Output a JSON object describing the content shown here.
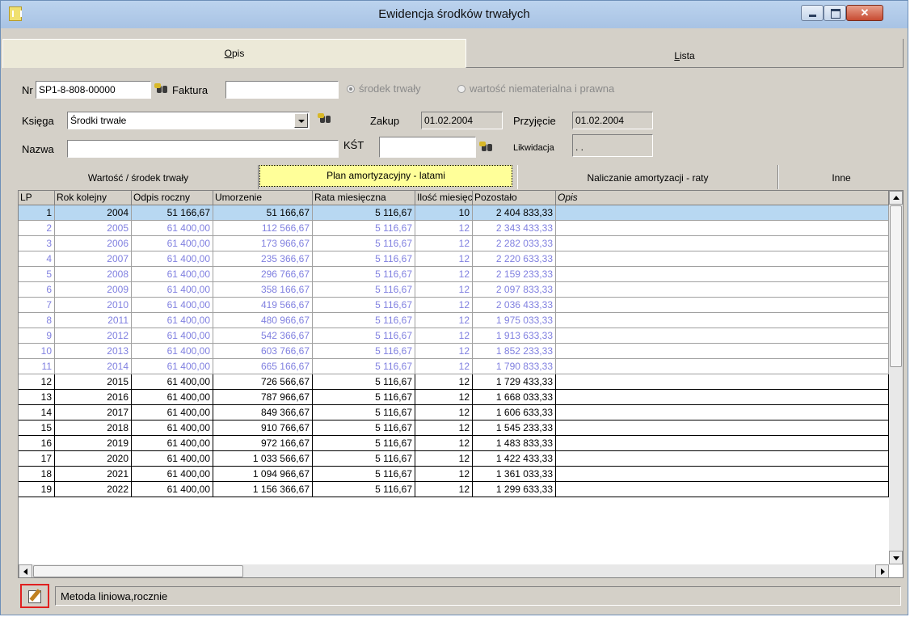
{
  "window": {
    "title": "Ewidencja środków trwałych"
  },
  "tabs_top": {
    "opis_prefix": "",
    "opis_underline": "O",
    "opis_rest": "pis",
    "lista_underline": "L",
    "lista_rest": "ista"
  },
  "form": {
    "nr_label": "Nr",
    "nr_value": "SP1-8-808-00000",
    "faktura_label": "Faktura",
    "faktura_value": "",
    "radio_srodek": "środek trwały",
    "radio_wartosc": "wartość niematerialna i prawna",
    "ksiega_label": "Księga",
    "ksiega_value": "Środki trwałe",
    "zakup_label": "Zakup",
    "zakup_value": "01.02.2004",
    "przyjecie_label": "Przyjęcie",
    "przyjecie_value": "01.02.2004",
    "nazwa_label": "Nazwa",
    "nazwa_value": "",
    "kst_label": "KŚT",
    "kst_value": "",
    "likwidacja_label": "Likwidacja",
    "likwidacja_value": " . ."
  },
  "tabs2": {
    "wartosc": "Wartość / środek trwały",
    "plan": "Plan amortyzacyjny - latami",
    "naliczanie": "Naliczanie amortyzacji - raty",
    "inne": "Inne"
  },
  "grid": {
    "columns": [
      "LP",
      "Rok kolejny",
      "Odpis roczny",
      "Umorzenie",
      "Rata miesięczna",
      "Ilość miesięcy",
      "Pozostało",
      "Opis"
    ],
    "rows": [
      [
        "1",
        "2004",
        "51 166,67",
        "51 166,67",
        "5 116,67",
        "10",
        "2 404 833,33",
        ""
      ],
      [
        "2",
        "2005",
        "61 400,00",
        "112 566,67",
        "5 116,67",
        "12",
        "2 343 433,33",
        ""
      ],
      [
        "3",
        "2006",
        "61 400,00",
        "173 966,67",
        "5 116,67",
        "12",
        "2 282 033,33",
        ""
      ],
      [
        "4",
        "2007",
        "61 400,00",
        "235 366,67",
        "5 116,67",
        "12",
        "2 220 633,33",
        ""
      ],
      [
        "5",
        "2008",
        "61 400,00",
        "296 766,67",
        "5 116,67",
        "12",
        "2 159 233,33",
        ""
      ],
      [
        "6",
        "2009",
        "61 400,00",
        "358 166,67",
        "5 116,67",
        "12",
        "2 097 833,33",
        ""
      ],
      [
        "7",
        "2010",
        "61 400,00",
        "419 566,67",
        "5 116,67",
        "12",
        "2 036 433,33",
        ""
      ],
      [
        "8",
        "2011",
        "61 400,00",
        "480 966,67",
        "5 116,67",
        "12",
        "1 975 033,33",
        ""
      ],
      [
        "9",
        "2012",
        "61 400,00",
        "542 366,67",
        "5 116,67",
        "12",
        "1 913 633,33",
        ""
      ],
      [
        "10",
        "2013",
        "61 400,00",
        "603 766,67",
        "5 116,67",
        "12",
        "1 852 233,33",
        ""
      ],
      [
        "11",
        "2014",
        "61 400,00",
        "665 166,67",
        "5 116,67",
        "12",
        "1 790 833,33",
        ""
      ],
      [
        "12",
        "2015",
        "61 400,00",
        "726 566,67",
        "5 116,67",
        "12",
        "1 729 433,33",
        ""
      ],
      [
        "13",
        "2016",
        "61 400,00",
        "787 966,67",
        "5 116,67",
        "12",
        "1 668 033,33",
        ""
      ],
      [
        "14",
        "2017",
        "61 400,00",
        "849 366,67",
        "5 116,67",
        "12",
        "1 606 633,33",
        ""
      ],
      [
        "15",
        "2018",
        "61 400,00",
        "910 766,67",
        "5 116,67",
        "12",
        "1 545 233,33",
        ""
      ],
      [
        "16",
        "2019",
        "61 400,00",
        "972 166,67",
        "5 116,67",
        "12",
        "1 483 833,33",
        ""
      ],
      [
        "17",
        "2020",
        "61 400,00",
        "1 033 566,67",
        "5 116,67",
        "12",
        "1 422 433,33",
        ""
      ],
      [
        "18",
        "2021",
        "61 400,00",
        "1 094 966,67",
        "5 116,67",
        "12",
        "1 361 033,33",
        ""
      ],
      [
        "19",
        "2022",
        "61 400,00",
        "1 156 366,67",
        "5 116,67",
        "12",
        "1 299 633,33",
        ""
      ]
    ],
    "selected_row": 0,
    "dimmed_rows": [
      1,
      2,
      3,
      4,
      5,
      6,
      7,
      8,
      9,
      10
    ]
  },
  "status": {
    "text": "Metoda liniowa,rocznie"
  }
}
